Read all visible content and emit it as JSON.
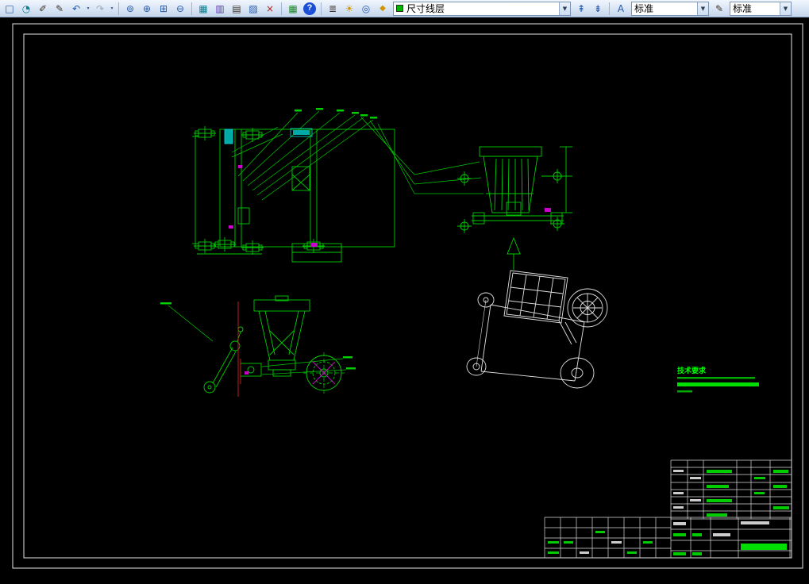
{
  "app": {
    "kind": "CAD drafting workspace"
  },
  "toolbar": {
    "dropdown_arrow_solid": "▼",
    "dropdown_arrow_mini": "▾",
    "icons": {
      "new_file": "□",
      "clock": "◔",
      "brush": "✐",
      "pen": "✎",
      "undo": "↶",
      "redo": "↷",
      "zoom_dynamic": "⊚",
      "zoom_in": "⊕",
      "zoom_window": "⊞",
      "zoom_out": "⊖",
      "table": "▦",
      "chart": "▥",
      "sheet": "▤",
      "export": "▨",
      "close_red": "×",
      "grid": "▦",
      "help": "?",
      "layers": "≣",
      "bulb": "☀",
      "globe": "◎",
      "lock": "◆",
      "layer_up": "⇞",
      "layer_down": "⇟",
      "text_style": "A",
      "annotate": "✎"
    },
    "layer_dropdown": {
      "value": "尺寸线层"
    },
    "style_dropdown": {
      "value": "标准"
    },
    "style_dropdown_right": {
      "value": "标准"
    }
  },
  "canvas": {
    "tech_requirements": {
      "title": "技术要求"
    },
    "colors": {
      "drawing_green": "#00cc00",
      "bright_green_text": "#00ff00",
      "highlight_cyan": "#00cccc",
      "highlight_magenta": "#cc00cc",
      "centerline_red": "#cc2222",
      "white_lines": "#e6e6e6",
      "paper_background": "#000000"
    }
  }
}
